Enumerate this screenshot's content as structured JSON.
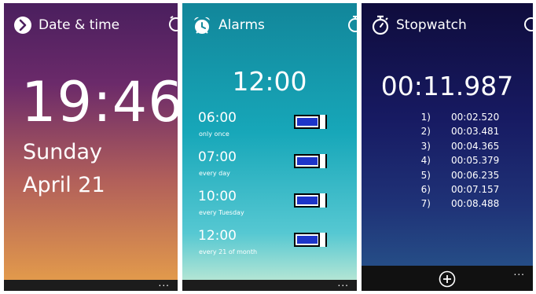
{
  "datetime_panel": {
    "title": "Date & time",
    "time": "19:46",
    "day": "Sunday",
    "date": "April 21"
  },
  "alarms_panel": {
    "title": "Alarms",
    "clock": "12:00",
    "alarms": [
      {
        "time": "06:00",
        "repeat": "only once",
        "enabled": true
      },
      {
        "time": "07:00",
        "repeat": "every day",
        "enabled": true
      },
      {
        "time": "10:00",
        "repeat": "every Tuesday",
        "enabled": true
      },
      {
        "time": "12:00",
        "repeat": "every 21 of month",
        "enabled": true
      }
    ]
  },
  "stopwatch_panel": {
    "title": "Stopwatch",
    "elapsed": "00:11.987",
    "laps": [
      {
        "n": "1)",
        "time": "00:02.520"
      },
      {
        "n": "2)",
        "time": "00:03.481"
      },
      {
        "n": "3)",
        "time": "00:04.365"
      },
      {
        "n": "4)",
        "time": "00:05.379"
      },
      {
        "n": "5)",
        "time": "00:06.235"
      },
      {
        "n": "6)",
        "time": "00:07.157"
      },
      {
        "n": "7)",
        "time": "00:08.488"
      }
    ]
  },
  "appbar": {
    "more": "..."
  },
  "icons": {
    "datetime": "chevron-circle-icon",
    "alarms": "alarm-clock-icon",
    "stopwatch": "stopwatch-icon",
    "add": "plus-circle-icon"
  },
  "colors": {
    "toggle_fill": "#1d35c9",
    "datetime_top": "#4a1f5e",
    "datetime_bottom": "#e7a04a",
    "alarms_top": "#12869a",
    "alarms_bottom": "#c8ecd5",
    "stopwatch_top": "#0f0c3c",
    "stopwatch_bottom": "#28588d"
  }
}
